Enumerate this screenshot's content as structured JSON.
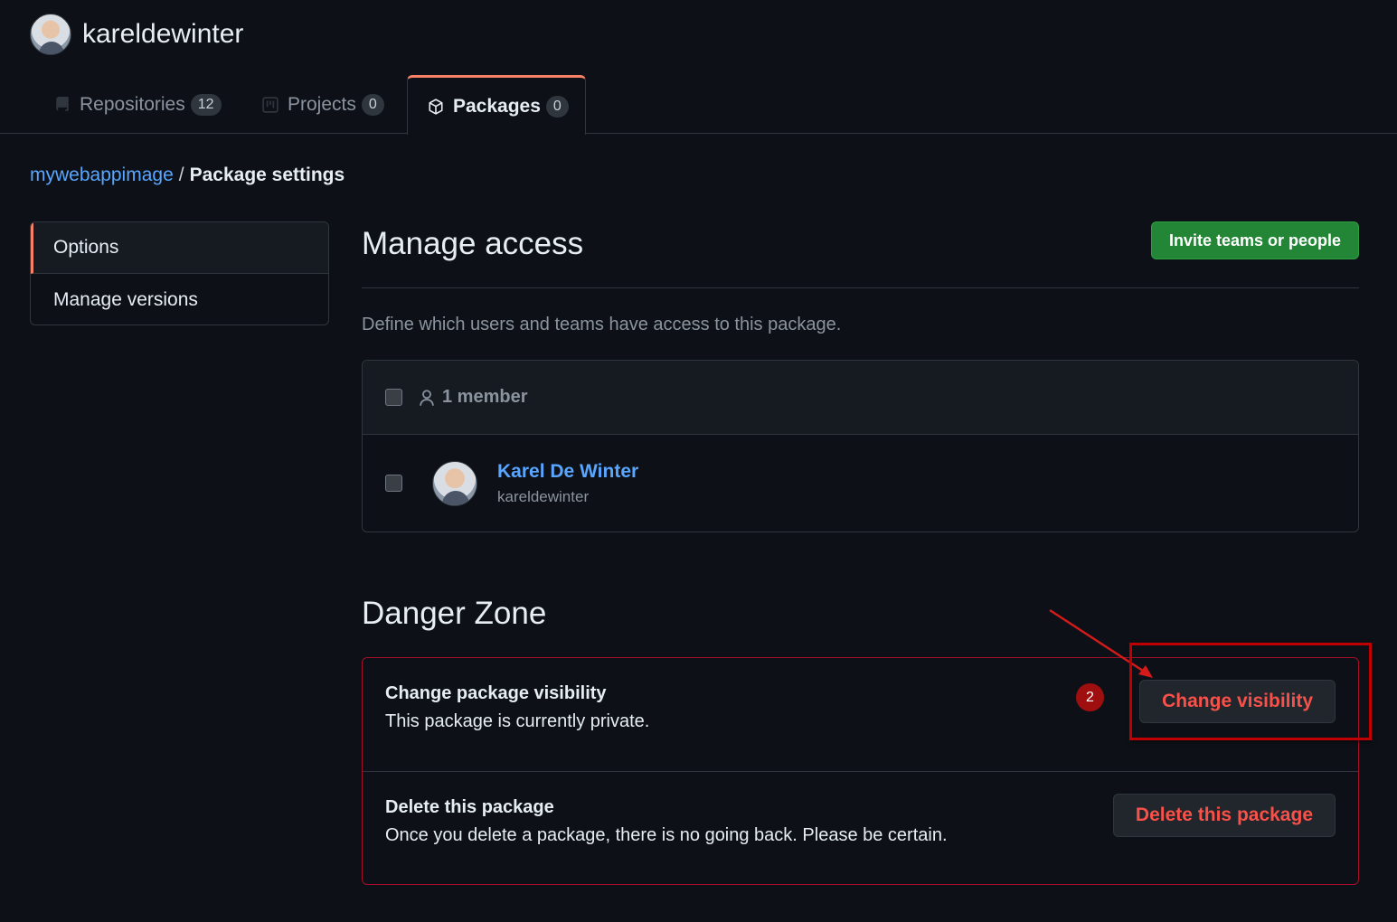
{
  "user": {
    "username": "kareldewinter"
  },
  "tabs": [
    {
      "label": "Repositories",
      "count": "12",
      "icon": "repo-icon"
    },
    {
      "label": "Projects",
      "count": "0",
      "icon": "project-icon"
    },
    {
      "label": "Packages",
      "count": "0",
      "icon": "package-icon",
      "active": true
    }
  ],
  "breadcrumb": {
    "link": "mywebappimage",
    "separator": "/",
    "current": "Package settings"
  },
  "sidebar": {
    "items": [
      {
        "label": "Options",
        "active": true
      },
      {
        "label": "Manage versions"
      }
    ]
  },
  "manage_access": {
    "title": "Manage access",
    "invite_label": "Invite teams or people",
    "description": "Define which users and teams have access to this package.",
    "member_count_label": "1 member",
    "members": [
      {
        "name": "Karel De Winter",
        "login": "kareldewinter"
      }
    ]
  },
  "danger_zone": {
    "title": "Danger Zone",
    "rows": [
      {
        "title": "Change package visibility",
        "description": "This package is currently private.",
        "button": "Change visibility"
      },
      {
        "title": "Delete this package",
        "description": "Once you delete a package, there is no going back. Please be certain.",
        "button": "Delete this package"
      }
    ]
  },
  "annotation": {
    "step": "2"
  },
  "colors": {
    "accent_tab": "#f78166",
    "link": "#58a6ff",
    "primary": "#238636",
    "danger": "#f85149",
    "annotation": "#c00000"
  }
}
